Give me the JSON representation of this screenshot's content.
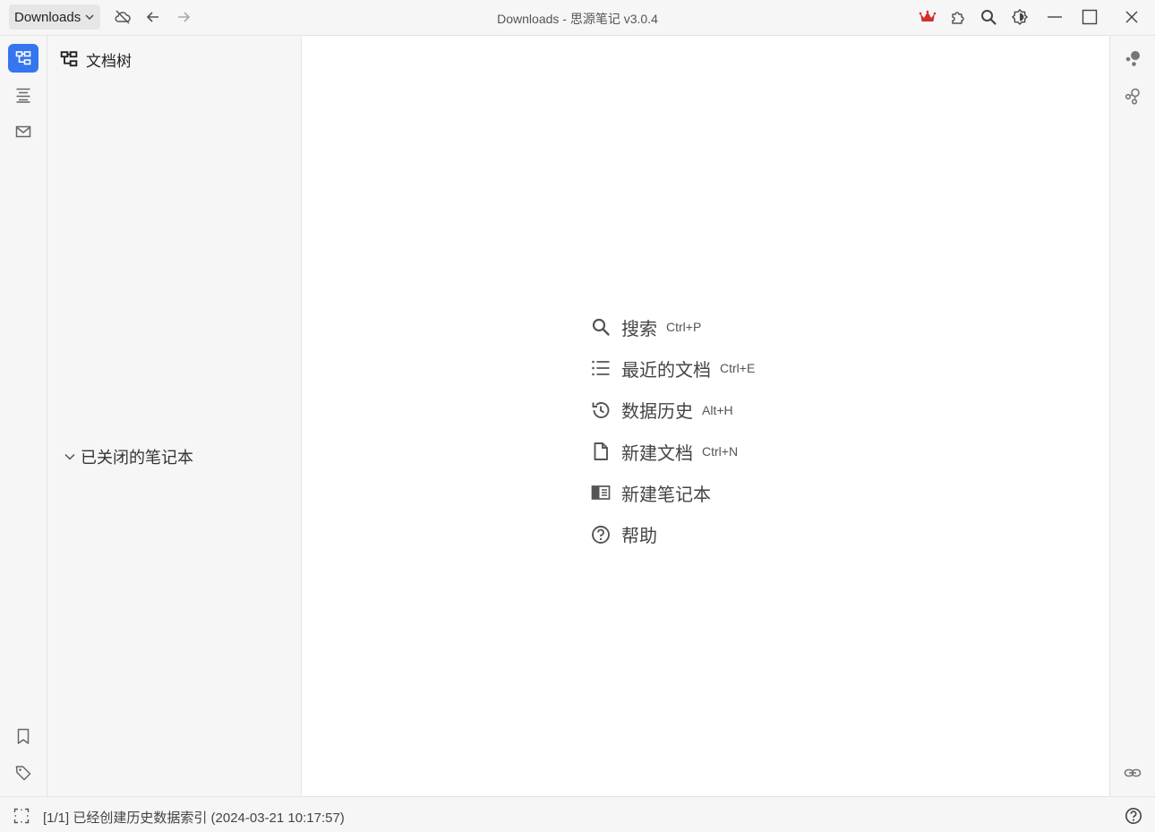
{
  "titlebar": {
    "workspace_label": "Downloads",
    "window_title": "Downloads - 思源笔记 v3.0.4",
    "icons": [
      "sync-cloud-icon",
      "back-arrow-icon",
      "forward-arrow-icon",
      "crown-icon",
      "plugin-icon",
      "search-icon",
      "theme-icon",
      "minimize-icon",
      "maximize-icon",
      "close-icon"
    ],
    "accent_color": "#d32f2f"
  },
  "left_dock": {
    "items": [
      {
        "name": "file-tree",
        "icon": "file-tree-icon",
        "active": true
      },
      {
        "name": "outline",
        "icon": "outline-icon",
        "active": false
      },
      {
        "name": "inbox",
        "icon": "inbox-icon",
        "active": false
      },
      {
        "name": "bookmark",
        "icon": "bookmark-icon",
        "active": false
      },
      {
        "name": "tag",
        "icon": "tag-icon",
        "active": false
      }
    ],
    "active_color": "#3575f0"
  },
  "tree_panel": {
    "title": "文档树",
    "closed_notebooks_label": "已关闭的笔记本"
  },
  "empty_state": {
    "items": [
      {
        "icon": "search-icon",
        "label": "搜索",
        "shortcut": "Ctrl+P"
      },
      {
        "icon": "recent-list-icon",
        "label": "最近的文档",
        "shortcut": "Ctrl+E"
      },
      {
        "icon": "history-icon",
        "label": "数据历史",
        "shortcut": "Alt+H"
      },
      {
        "icon": "new-doc-icon",
        "label": "新建文档",
        "shortcut": "Ctrl+N"
      },
      {
        "icon": "new-notebook-icon",
        "label": "新建笔记本",
        "shortcut": ""
      },
      {
        "icon": "help-icon",
        "label": "帮助",
        "shortcut": ""
      }
    ]
  },
  "right_dock": {
    "items": [
      {
        "name": "graph",
        "icon": "graph-icon"
      },
      {
        "name": "global-graph",
        "icon": "global-graph-icon"
      },
      {
        "name": "backlinks",
        "icon": "link-icon"
      }
    ]
  },
  "statusbar": {
    "message": "[1/1] 已经创建历史数据索引 (2024-03-21 10:17:57)",
    "icons": [
      "dock-toggle-icon",
      "help-icon"
    ]
  }
}
